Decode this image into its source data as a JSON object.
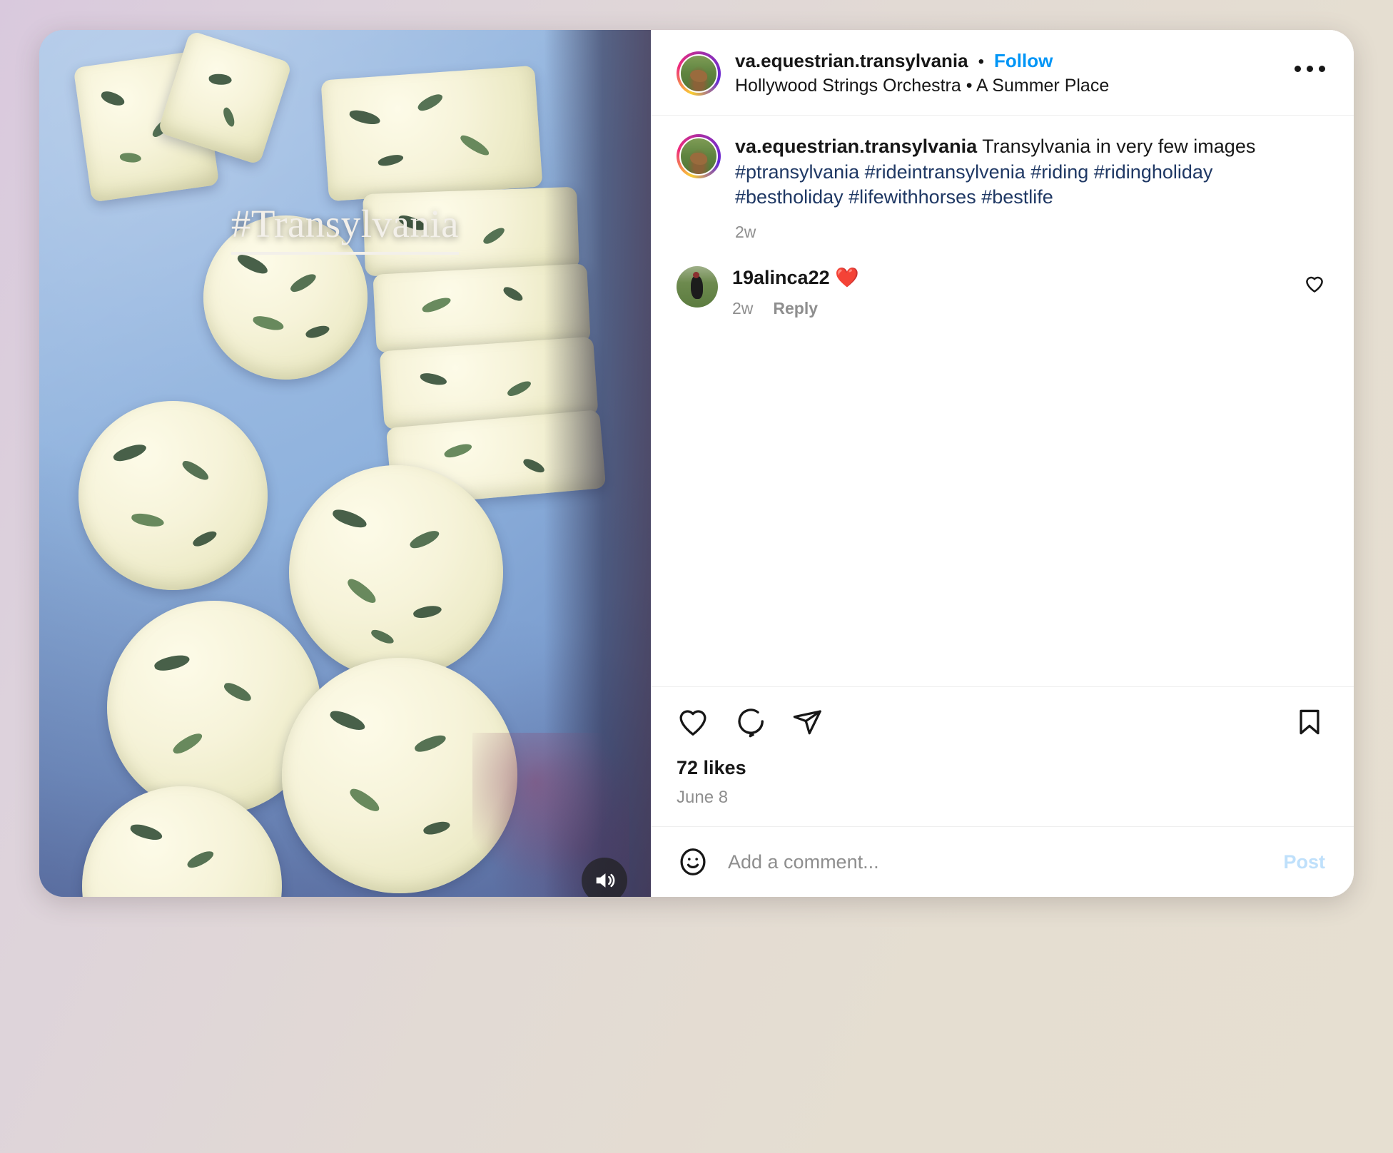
{
  "header": {
    "username": "va.equestrian.transylvania",
    "separator": "•",
    "follow_label": "Follow",
    "audio_meta": "Hollywood Strings Orchestra  •  A Summer Place",
    "more_icon": "ellipsis-icon",
    "avatar_icon": "story-ring-avatar"
  },
  "media": {
    "overlay_caption": "#Transylvania",
    "audio_icon": "speaker-on-icon",
    "alt": "Sliced herb butter rounds on a pale blue plate"
  },
  "caption": {
    "username": "va.equestrian.transylvania",
    "text": "Transylvania in very few images",
    "hashtags": "#ptransylvania #rideintransylvenia #riding #ridingholiday #bestholiday #lifewithhorses #bestlife",
    "time": "2w"
  },
  "comment": {
    "username": "19alinca22",
    "emoji": "❤️",
    "time": "2w",
    "reply_label": "Reply",
    "like_icon": "heart-outline-icon"
  },
  "actions": {
    "like_icon": "heart-outline-icon",
    "comment_icon": "speech-bubble-icon",
    "share_icon": "paper-plane-icon",
    "save_icon": "bookmark-outline-icon",
    "likes": "72 likes",
    "date": "June 8"
  },
  "add_comment": {
    "emoji_icon": "smiley-face-icon",
    "placeholder": "Add a comment...",
    "value": "",
    "post_label": "Post"
  },
  "colors": {
    "link_blue": "#0095f6",
    "hashtag_navy": "#1f3864",
    "muted_gray": "#8e8e8e",
    "post_disabled": "#bfe0fb"
  }
}
